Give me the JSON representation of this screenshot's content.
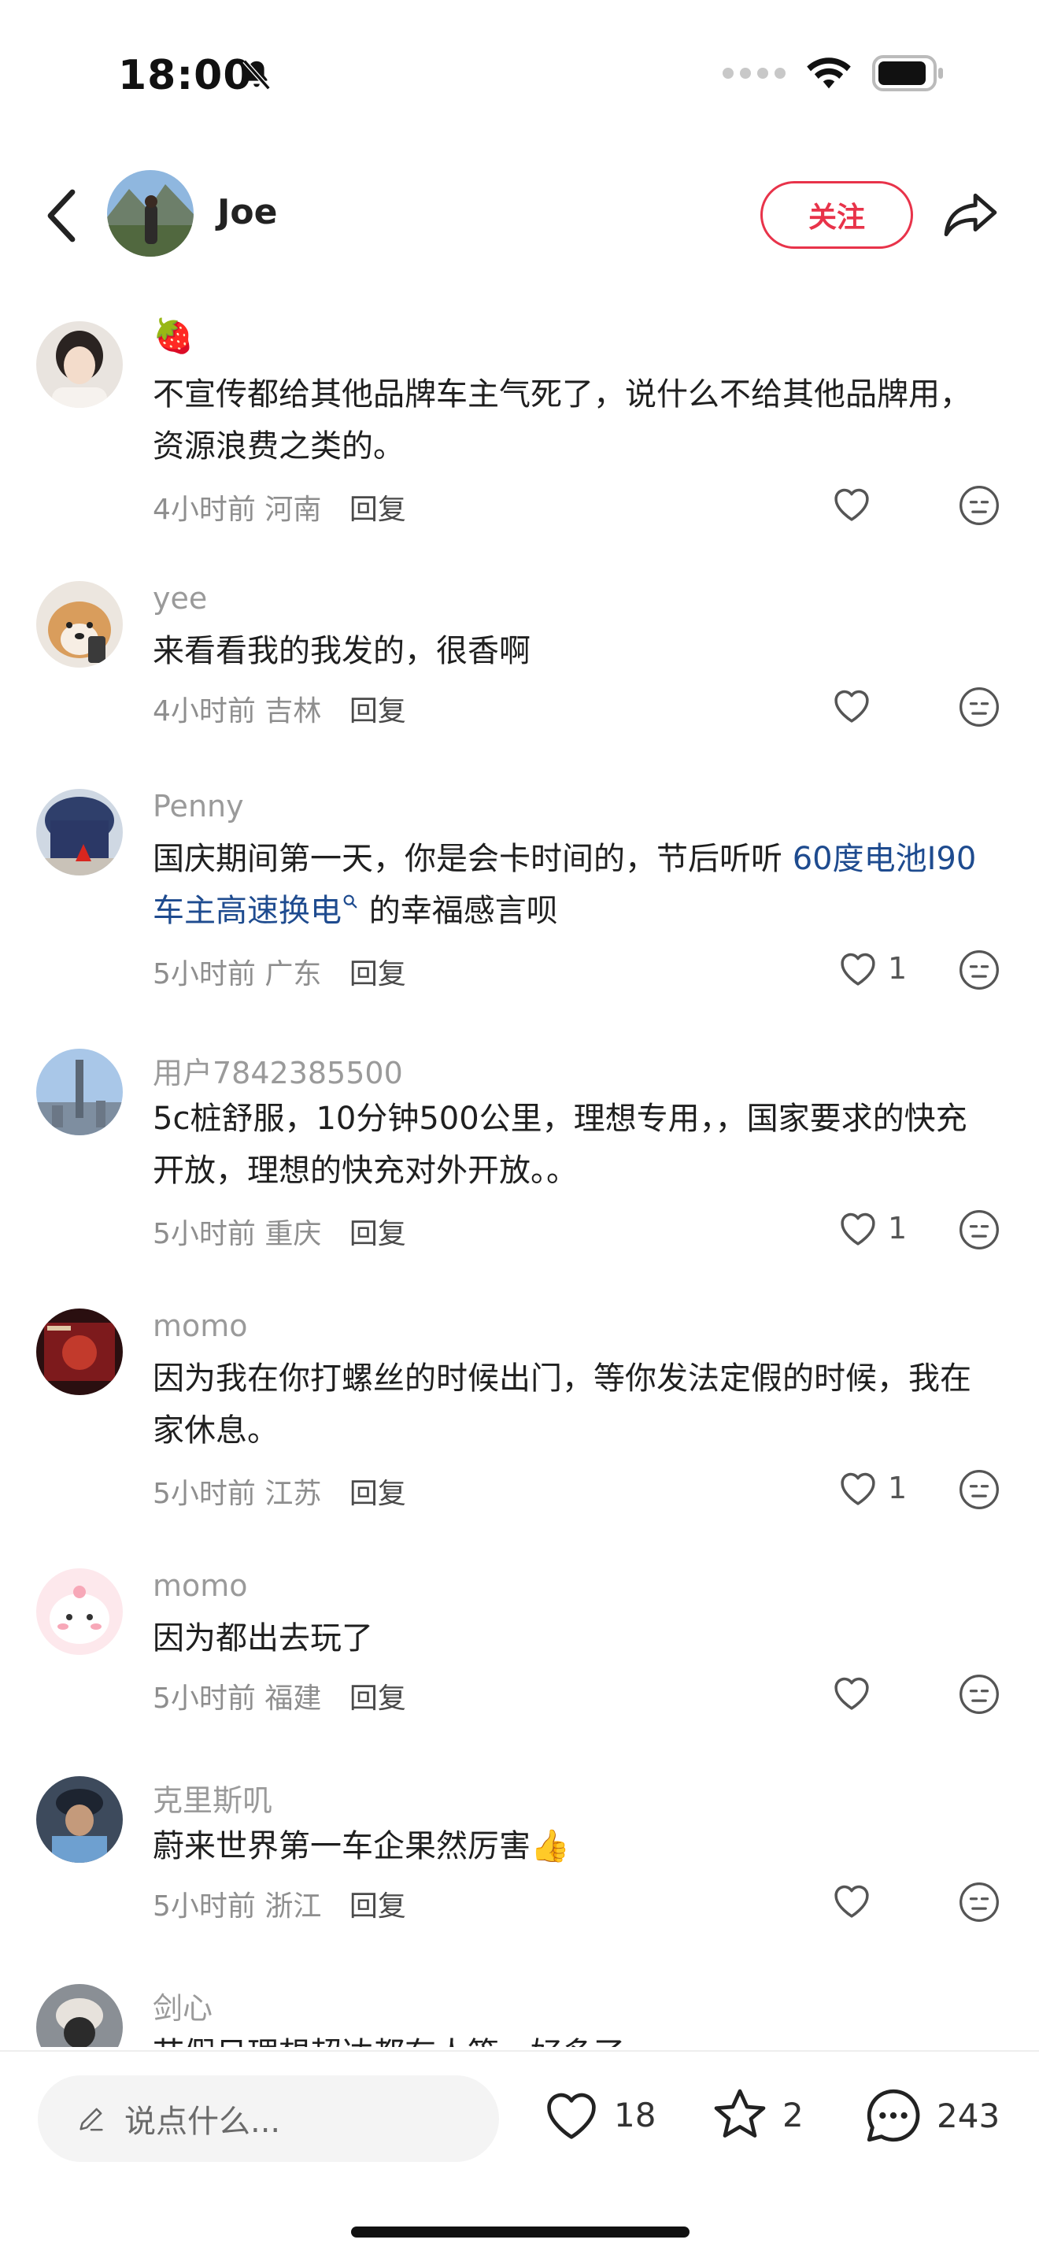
{
  "status_bar": {
    "time": "18:00",
    "icons": [
      "bell-slash-icon",
      "signal-dots-icon",
      "wifi-icon",
      "battery-icon"
    ]
  },
  "nav": {
    "username": "Joe",
    "follow_label": "关注",
    "icons": [
      "back-arrow-icon",
      "share-icon"
    ]
  },
  "comments": [
    {
      "author": "🍓",
      "text": "不宣传都给其他品牌车主气死了，说什么不给其他品牌用，资源浪费之类的。",
      "time": "4小时前",
      "location": "河南",
      "reply": "回复",
      "likes": ""
    },
    {
      "author": "yee",
      "text": "来看看我的我发的，很香啊",
      "time": "4小时前",
      "location": "吉林",
      "reply": "回复",
      "likes": ""
    },
    {
      "author": "Penny",
      "text_before": "国庆期间第一天，你是会卡时间的，节后听听 ",
      "link": "60度电池I90车主高速换电",
      "text_after": " 的幸福感言呗",
      "time": "5小时前",
      "location": "广东",
      "reply": "回复",
      "likes": "1"
    },
    {
      "author": "用户7842385500",
      "text": "5c桩舒服，10分钟500公里，理想专用，，国家要求的快充开放，理想的快充对外开放。。",
      "time": "5小时前",
      "location": "重庆",
      "reply": "回复",
      "likes": "1"
    },
    {
      "author": "momo",
      "text": "因为我在你打螺丝的时候出门，等你发法定假的时候，我在家休息。",
      "time": "5小时前",
      "location": "江苏",
      "reply": "回复",
      "likes": "1"
    },
    {
      "author": "momo",
      "text": "因为都出去玩了",
      "time": "5小时前",
      "location": "福建",
      "reply": "回复",
      "likes": ""
    },
    {
      "author": "克里斯叽",
      "text": "蔚来世界第一车企果然厉害👍",
      "time": "5小时前",
      "location": "浙江",
      "reply": "回复",
      "likes": ""
    },
    {
      "author": "剑心",
      "text": "节假日理想超达都有人等，好多了",
      "time": "",
      "location": "",
      "reply": "",
      "likes": ""
    }
  ],
  "bottom_bar": {
    "input_placeholder": "说点什么...",
    "like_count": "18",
    "star_count": "2",
    "comment_count": "243"
  }
}
